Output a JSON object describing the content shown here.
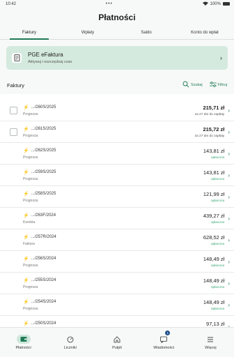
{
  "status": {
    "time": "10:42",
    "dots": "•••",
    "battery": "100%"
  },
  "header": {
    "title": "Płatności"
  },
  "tabs": [
    {
      "label": "Faktury",
      "active": true
    },
    {
      "label": "Wpłaty",
      "active": false
    },
    {
      "label": "Saldo",
      "active": false
    },
    {
      "label": "Konto do wpłat",
      "active": false
    }
  ],
  "banner": {
    "title": "PGE eFaktura",
    "subtitle": "Aktywuj i oszczędzaj czas"
  },
  "list": {
    "title": "Faktury",
    "search_label": "Szukaj",
    "filter_label": "Filtruj"
  },
  "rows": [
    {
      "number": ".../260S/2025",
      "type": "Prognoza",
      "amount": "215,71 zł",
      "status": "za 27 dni do zapłaty",
      "paid": false,
      "checkbox": true
    },
    {
      "number": ".../261S/2025",
      "type": "Prognoza",
      "amount": "215,72 zł",
      "status": "za 27 dni do zapłaty",
      "paid": false,
      "checkbox": true
    },
    {
      "number": ".../262S/2025",
      "type": "Prognoza",
      "amount": "143,81 zł",
      "status": "opłacono",
      "paid": true,
      "checkbox": false
    },
    {
      "number": ".../259S/2025",
      "type": "Prognoza",
      "amount": "143,81 zł",
      "status": "opłacono",
      "paid": true,
      "checkbox": false
    },
    {
      "number": ".../258S/2025",
      "type": "Prognoza",
      "amount": "121,99 zł",
      "status": "opłacono",
      "paid": true,
      "checkbox": false
    },
    {
      "number": ".../263F/2024",
      "type": "Korekta",
      "amount": "439,27 zł",
      "status": "opłacono",
      "paid": true,
      "checkbox": false
    },
    {
      "number": ".../257R/2024",
      "type": "Faktura",
      "amount": "628,52 zł",
      "status": "opłacono",
      "paid": true,
      "checkbox": false
    },
    {
      "number": ".../256S/2024",
      "type": "Prognoza",
      "amount": "148,49 zł",
      "status": "opłacono",
      "paid": true,
      "checkbox": false
    },
    {
      "number": ".../255S/2024",
      "type": "Prognoza",
      "amount": "148,49 zł",
      "status": "opłacono",
      "paid": true,
      "checkbox": false
    },
    {
      "number": ".../254S/2024",
      "type": "Prognoza",
      "amount": "148,49 zł",
      "status": "opłacono",
      "paid": true,
      "checkbox": false
    },
    {
      "number": ".../250S/2024",
      "type": "Prognoza",
      "amount": "97,13 zł",
      "status": "opłacono",
      "paid": true,
      "checkbox": false
    }
  ],
  "nav": [
    {
      "label": "Płatności",
      "icon": "wallet-icon",
      "active": true
    },
    {
      "label": "Liczniki",
      "icon": "meter-icon",
      "active": false
    },
    {
      "label": "Pulpit",
      "icon": "home-icon",
      "active": false
    },
    {
      "label": "Wiadomości",
      "icon": "message-icon",
      "active": false,
      "badge": "1"
    },
    {
      "label": "Więcej",
      "icon": "more-icon",
      "active": false
    }
  ],
  "colors": {
    "accent": "#1f7a55",
    "banner_bg": "#d5eadf",
    "paid": "#3aa876",
    "bolt": "#3b9a3e"
  }
}
